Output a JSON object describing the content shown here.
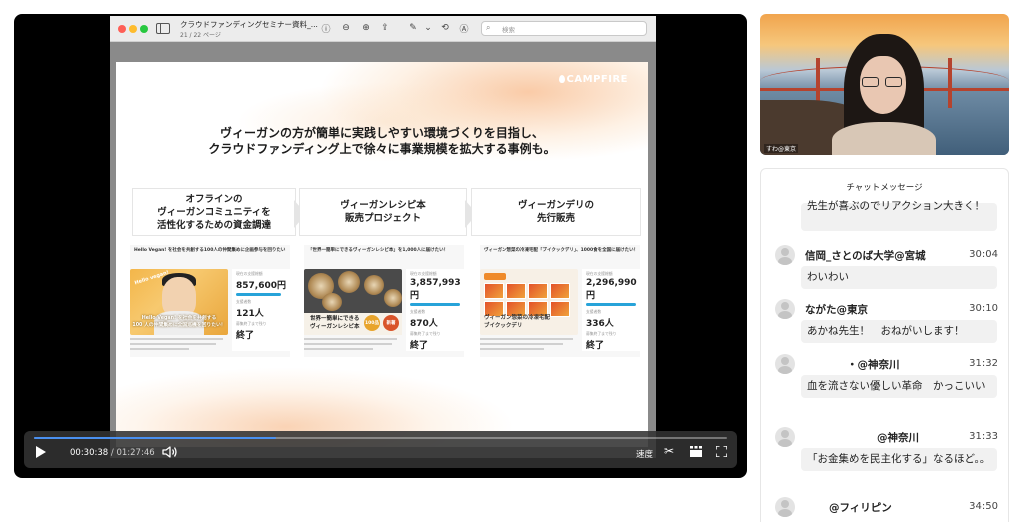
{
  "pdf": {
    "title": "クラウドファンディングセミナー資料_...",
    "pages": "21 / 22 ページ",
    "search_placeholder": "検索"
  },
  "slide": {
    "logo": "CAMPFIRE",
    "headline_line1": "ヴィーガンの方が簡単に実践しやすい環境づくりを目指し、",
    "headline_line2": "クラウドファンディング上で徐々に事業規模を拡大する事例も。",
    "labels": [
      {
        "line1": "オフラインの",
        "line2": "ヴィーガンコミュニティを",
        "line3": "活性化するための資金調達"
      },
      {
        "line1": "ヴィーガンレシピ本",
        "line2": "販売プロジェクト",
        "line3": ""
      },
      {
        "line1": "ヴィーガンデリの",
        "line2": "先行販売",
        "line3": ""
      }
    ],
    "cards": [
      {
        "title": "Hello Vegan! を社会を共創する100人の仲間集めに企画参与を回りたい！",
        "caption_line1": "Hello Vegan! を社会を共創する",
        "caption_line2": "100 人の仲間集めに全国巡機を回りたい！",
        "badge": "Hello vegan!",
        "amount_caption": "現在の支援総額",
        "amount": "857,600円",
        "supporters_caption": "支援者数",
        "supporters": "121人",
        "remaining_caption": "募集終了まで残り",
        "remaining": "終了",
        "progress": 0.9
      },
      {
        "title": "「世界一簡単にできるヴィーガンレシピ本」を1,000人に届けたい！",
        "caption_line1": "世界一簡単にできる",
        "caption_line2": "ヴィーガンレシピ本",
        "circle1": "100品",
        "circle2": "新著",
        "amount_caption": "現在の支援総額",
        "amount": "3,857,993円",
        "supporters_caption": "支援者数",
        "supporters": "870人",
        "remaining_caption": "募集終了まで残り",
        "remaining": "終了",
        "progress": 1.0
      },
      {
        "title": "ヴィーガン惣菜の冷凍宅配「ブイクックデリ」、1000食を全国に届けたい！",
        "caption_line1": "ヴィーガン惣菜の冷凍宅配",
        "caption_line2": "ブイクックデリ",
        "amount_caption": "現在の支援総額",
        "amount": "2,296,990円",
        "supporters_caption": "支援者数",
        "supporters": "336人",
        "remaining_caption": "募集終了まで残り",
        "remaining": "終了",
        "progress": 1.0
      }
    ]
  },
  "player": {
    "current_time": "00:30:38",
    "separator": " / ",
    "duration": "01:27:46",
    "speed_label": "速度",
    "progress": 0.349
  },
  "webcam": {
    "name": "すわ@東京"
  },
  "chat": {
    "header": "チャットメッセージ",
    "partial_message": "先生が喜ぶのでリアクション大きく！",
    "messages": [
      {
        "author": "信岡_さとのば大学@宮城",
        "time": "30:04",
        "text": "わいわい"
      },
      {
        "author": "ながた@東京",
        "time": "30:10",
        "text": "あかね先生！　おねがいします！"
      },
      {
        "author": "・@神奈川",
        "time": "31:32",
        "text": "血を流さない優しい革命　かっこいい"
      },
      {
        "author": "@神奈川",
        "time": "31:33",
        "text": "「お金集めを民主化する」なるほど。。"
      },
      {
        "author": "@フィリピン",
        "time": "34:50",
        "text": ""
      }
    ]
  },
  "colors": {
    "accent_blue": "#4a90f0",
    "campfire_orange": "#f08a3a",
    "progress_blue": "#27a3d9"
  }
}
